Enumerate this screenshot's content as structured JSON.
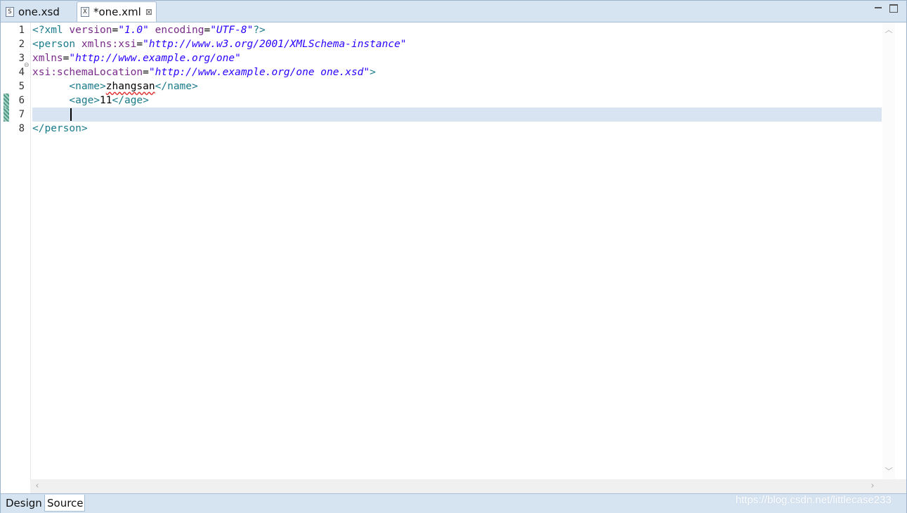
{
  "tabs": [
    {
      "icon": "S",
      "label": "one.xsd",
      "active": false
    },
    {
      "icon": "X",
      "label": "*one.xml",
      "active": true,
      "close": "⊠"
    }
  ],
  "editor": {
    "line_numbers": [
      "1",
      "2",
      "3",
      "4",
      "5",
      "6",
      "7",
      "8"
    ],
    "lines": [
      [
        {
          "t": "tag",
          "s": "<?xml "
        },
        {
          "t": "attr",
          "s": "version"
        },
        {
          "t": "txt",
          "s": "="
        },
        {
          "t": "val",
          "s": "\"1.0\""
        },
        {
          "t": "txt",
          "s": " "
        },
        {
          "t": "attr",
          "s": "encoding"
        },
        {
          "t": "txt",
          "s": "="
        },
        {
          "t": "val",
          "s": "\"UTF-8\""
        },
        {
          "t": "tag",
          "s": "?>"
        }
      ],
      [
        {
          "t": "tag",
          "s": "<person "
        },
        {
          "t": "attr",
          "s": "xmlns:xsi"
        },
        {
          "t": "txt",
          "s": "="
        },
        {
          "t": "val",
          "s": "\"http://www.w3.org/2001/XMLSchema-instance\""
        }
      ],
      [
        {
          "t": "attr",
          "s": "xmlns"
        },
        {
          "t": "txt",
          "s": "="
        },
        {
          "t": "val",
          "s": "\"http://www.example.org/one\""
        }
      ],
      [
        {
          "t": "attr",
          "s": "xsi:schemaLocation"
        },
        {
          "t": "txt",
          "s": "="
        },
        {
          "t": "val",
          "s": "\"http://www.example.org/one one.xsd\""
        },
        {
          "t": "tag",
          "s": ">"
        }
      ],
      [
        {
          "t": "txt",
          "s": "      "
        },
        {
          "t": "tag",
          "s": "<name>"
        },
        {
          "t": "spell",
          "s": "zhangsan"
        },
        {
          "t": "tag",
          "s": "</name>"
        }
      ],
      [
        {
          "t": "txt",
          "s": "      "
        },
        {
          "t": "tag",
          "s": "<age>"
        },
        {
          "t": "txt",
          "s": "11"
        },
        {
          "t": "tag",
          "s": "</age>"
        }
      ],
      [],
      [
        {
          "t": "tag",
          "s": "</person>"
        }
      ]
    ]
  },
  "page_tabs": {
    "design": "Design",
    "source": "Source",
    "active": "Source"
  },
  "watermark": "https://blog.csdn.net/littlecase233",
  "colors": {
    "tag": "#1a7a8a",
    "attribute": "#7a2a8a",
    "value": "#2a00ff",
    "current_line": "#d8e4f1"
  }
}
